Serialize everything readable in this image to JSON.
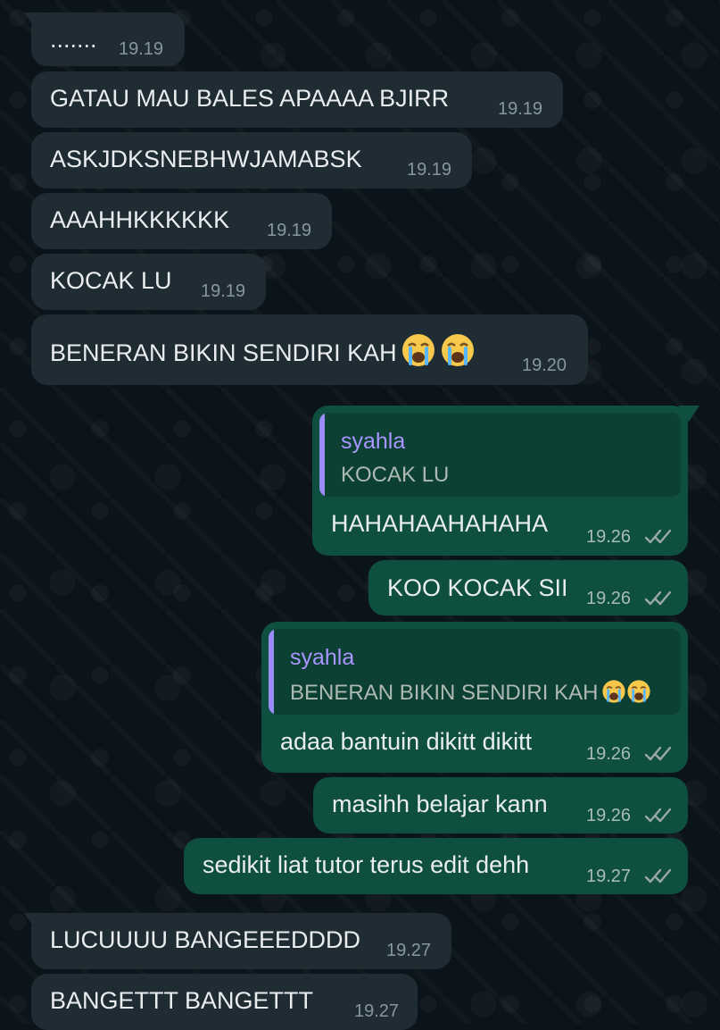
{
  "chat": {
    "messages": [
      {
        "text": ".......",
        "time": "19.19"
      },
      {
        "text": "GATAU MAU BALES APAAAA BJIRR",
        "time": "19.19"
      },
      {
        "text": "ASKJDKSNEBHWJAMABSK",
        "time": "19.19"
      },
      {
        "text": "AAAHHKKKKKK",
        "time": "19.19"
      },
      {
        "text": "KOCAK LU",
        "time": "19.19"
      },
      {
        "text": "BENERAN BIKIN SENDIRI KAH",
        "time": "19.20"
      },
      {
        "reply_name": "syahla",
        "reply_text": "KOCAK LU",
        "text": "HAHAHAAHAHAHA",
        "time": "19.26"
      },
      {
        "text": "KOO KOCAK SII",
        "time": "19.26"
      },
      {
        "reply_name": "syahla",
        "reply_text": "BENERAN BIKIN SENDIRI KAH",
        "text": "adaa bantuin dikitt dikitt",
        "time": "19.26"
      },
      {
        "text": "masihh belajar kann",
        "time": "19.26"
      },
      {
        "text": "sedikit liat tutor terus edit dehh",
        "time": "19.27"
      },
      {
        "text": "LUCUUUU BANGEEEDDDD",
        "time": "19.27"
      },
      {
        "text": "BANGETTT BANGETTT",
        "time": "19.27"
      }
    ]
  },
  "icons": {
    "crying": "loudly-crying-face-emoji",
    "read": "read-receipt-double-check-icon"
  },
  "colors": {
    "background": "#0b141a",
    "incoming_bubble": "#202c33",
    "outgoing_bubble": "#0f4f3f",
    "reply_name": "#a995ff",
    "read_check": "#9aa9a4"
  }
}
